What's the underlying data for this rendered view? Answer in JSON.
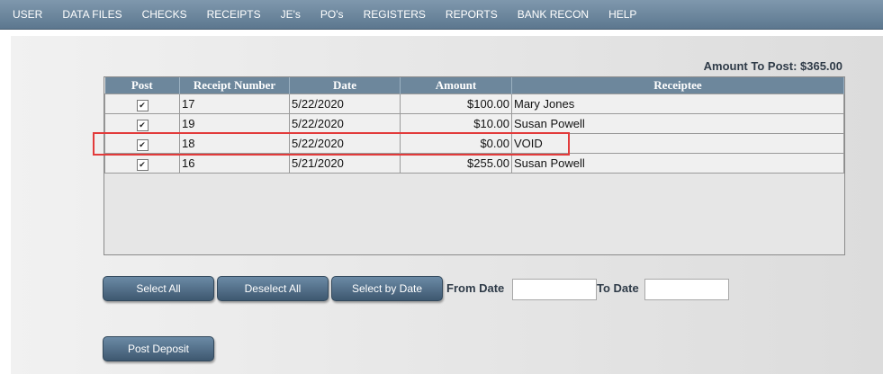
{
  "menu": [
    "USER",
    "DATA FILES",
    "CHECKS",
    "RECEIPTS",
    "JE's",
    "PO's",
    "REGISTERS",
    "REPORTS",
    "BANK RECON",
    "HELP"
  ],
  "amount_to_post": "Amount To Post: $365.00",
  "grid": {
    "headers": [
      "Post",
      "Receipt Number",
      "Date",
      "Amount",
      "Receiptee"
    ],
    "rows": [
      {
        "checked": true,
        "receipt": "17",
        "date": "5/22/2020",
        "amount": "$100.00",
        "receiptee": "Mary Jones"
      },
      {
        "checked": true,
        "receipt": "19",
        "date": "5/22/2020",
        "amount": "$10.00",
        "receiptee": "Susan Powell"
      },
      {
        "checked": true,
        "receipt": "18",
        "date": "5/22/2020",
        "amount": "$0.00",
        "receiptee": "VOID"
      },
      {
        "checked": true,
        "receipt": "16",
        "date": "5/21/2020",
        "amount": "$255.00",
        "receiptee": "Susan Powell"
      }
    ]
  },
  "buttons": {
    "select_all": "Select All",
    "deselect_all": "Deselect All",
    "select_by_date": "Select by Date",
    "post_deposit": "Post Deposit"
  },
  "filters": {
    "from_label": "From Date",
    "from_value": "",
    "to_label": "To Date",
    "to_value": ""
  },
  "colors": {
    "highlight": "#e23b3b",
    "menubar": "#6a8399"
  }
}
